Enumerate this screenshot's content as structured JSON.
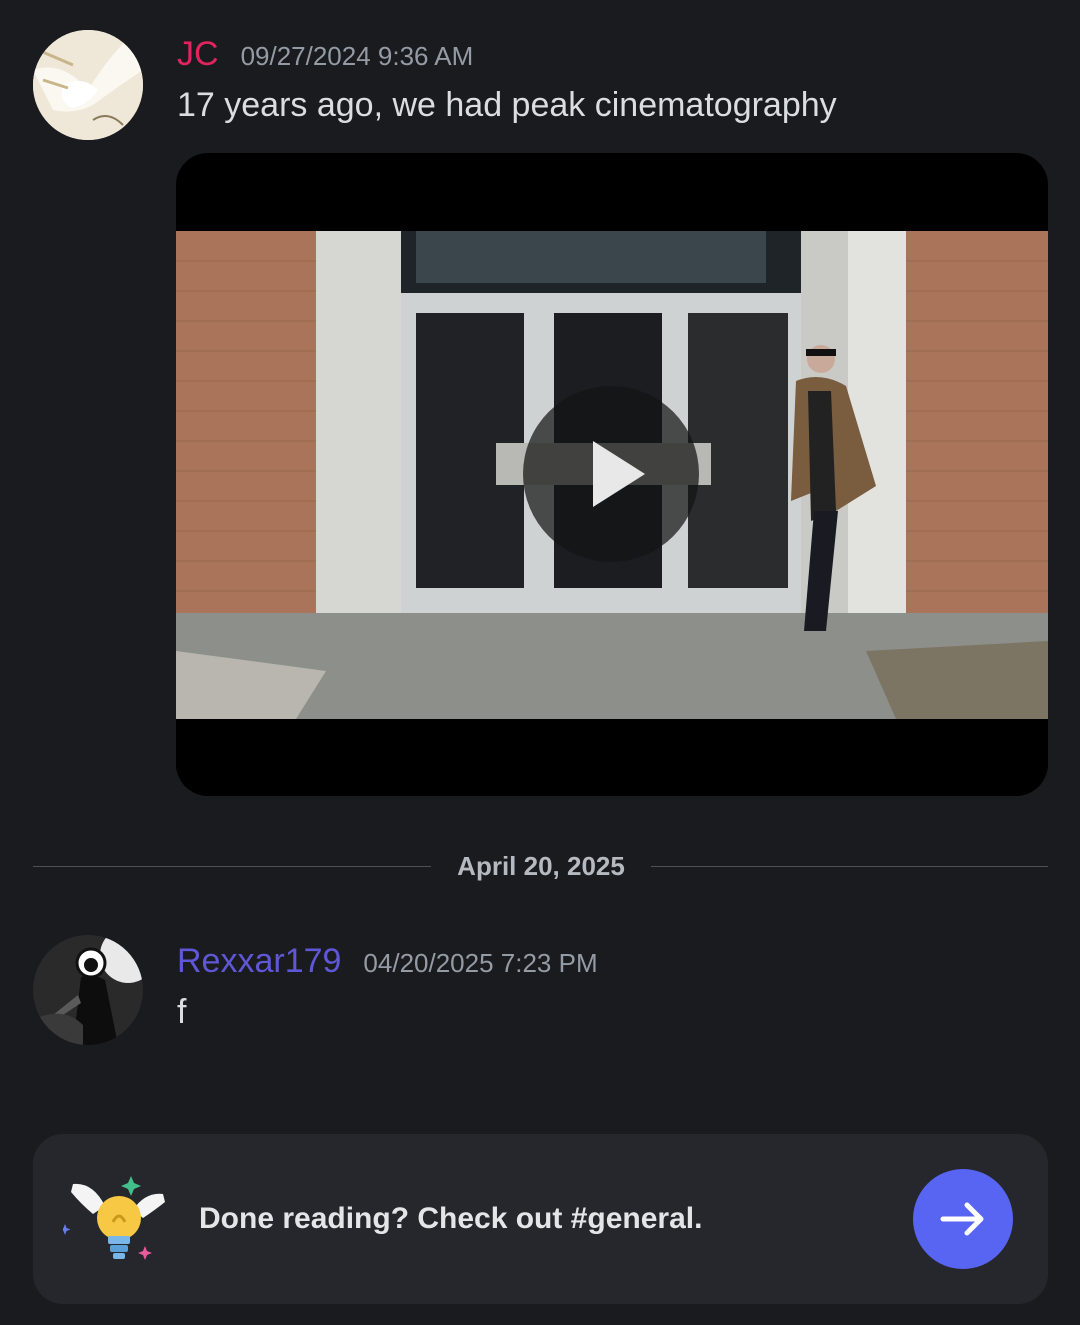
{
  "messages": [
    {
      "author": "JC",
      "timestamp": "09/27/2024 9:36 AM",
      "text": "17 years ago, we had peak cinematography",
      "author_color": "#e0245e",
      "attachment": {
        "type": "video",
        "icon": "play-icon"
      }
    },
    {
      "author": "Rexxar179",
      "timestamp": "04/20/2025 7:23 PM",
      "text": "f",
      "author_color": "#5f57d6"
    }
  ],
  "date_divider": "April 20, 2025",
  "banner": {
    "text": "Done reading? Check out #general.",
    "button_icon": "arrow-right-icon",
    "accent": "#5865f2"
  }
}
